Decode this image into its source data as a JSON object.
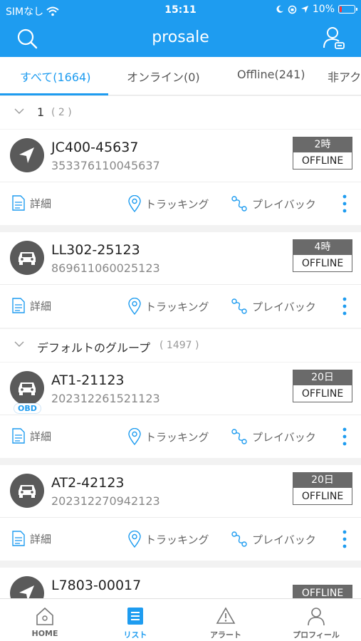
{
  "status_bar": {
    "carrier": "SIMなし",
    "time": "15:11",
    "battery": "10%"
  },
  "header": {
    "title": "prosale"
  },
  "tabs": [
    {
      "label": "すべて(1664)"
    },
    {
      "label": "オンライン(0)"
    },
    {
      "label": "Offline(241)"
    },
    {
      "label": "非アク"
    }
  ],
  "groups": [
    {
      "name": "1",
      "count": "( 2 )"
    },
    {
      "name": "デフォルトのグループ",
      "count": "( 1497 )"
    }
  ],
  "actions": {
    "detail": "詳細",
    "tracking": "トラッキング",
    "playback": "プレイバック"
  },
  "devices": [
    {
      "name": "JC400-45637",
      "imei": "353376110045637",
      "time": "2時",
      "status": "OFFLINE",
      "icon": "arrow-icon"
    },
    {
      "name": "LL302-25123",
      "imei": "869611060025123",
      "time": "4時",
      "status": "OFFLINE",
      "icon": "car-icon"
    },
    {
      "name": "AT1-21123",
      "imei": "202312261521123",
      "time": "20日",
      "status": "OFFLINE",
      "icon": "car-icon",
      "badge": "OBD"
    },
    {
      "name": "AT2-42123",
      "imei": "202312270942123",
      "time": "20日",
      "status": "OFFLINE",
      "icon": "car-icon"
    },
    {
      "name": "L7803-00017",
      "status": "OFFLINE",
      "icon": "arrow-icon"
    }
  ],
  "bottom_nav": [
    {
      "label": "HOME"
    },
    {
      "label": "リスト"
    },
    {
      "label": "アラート"
    },
    {
      "label": "プロフィール"
    }
  ],
  "colors": {
    "accent": "#1e9cf0",
    "avatar": "#5a5a5a",
    "status_box": "#6a6a6a"
  }
}
